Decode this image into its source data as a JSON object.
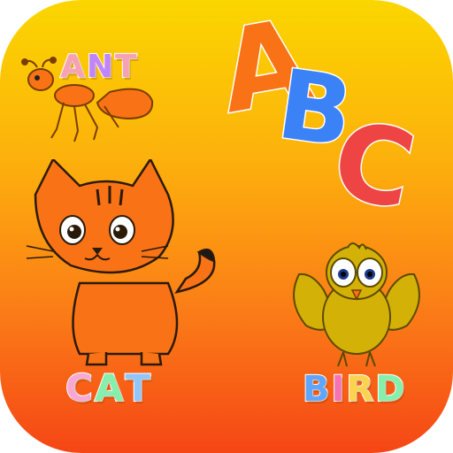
{
  "icon": {
    "words": {
      "ant": [
        "A",
        "N",
        "T"
      ],
      "cat": [
        "C",
        "A",
        "T"
      ],
      "bird": [
        "B",
        "I",
        "R",
        "D"
      ]
    },
    "abc": [
      "A",
      "B",
      "C"
    ]
  },
  "colors": {
    "gradient_top": "#fbd600",
    "gradient_bottom": "#f54616",
    "ant_letters": [
      "#f7a1b7",
      "#c084fc",
      "#f7a1b7"
    ],
    "cat_letters": [
      "#f9a8d4",
      "#86efac",
      "#93c5fd"
    ],
    "bird_letters": [
      "#60a5fa",
      "#f472b6",
      "#fcd34d",
      "#86efac"
    ],
    "abc_letters": [
      "#f97316",
      "#3b82f6",
      "#ef4444"
    ]
  }
}
